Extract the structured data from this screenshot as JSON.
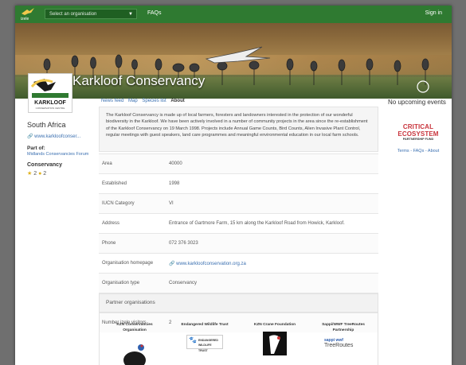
{
  "topbar": {
    "logo_text": "izele",
    "org_select_placeholder": "Select an organisation",
    "faqs_label": "FAQs",
    "signin_label": "Sign in"
  },
  "org": {
    "name": "Karkloof Conservancy",
    "logo_text": "KARKLOOF",
    "logo_subtext": "CONSERVATION CENTRE"
  },
  "tabs": [
    "News feed",
    "Map",
    "Species list",
    "About"
  ],
  "sidebar": {
    "country": "South Africa",
    "website_short": "www.karkloofconser...",
    "part_of_label": "Part of:",
    "part_of_link": "Midlands Conservancies Forum",
    "type_label": "Conservancy",
    "favourites_count": "2",
    "visitors_count": "2"
  },
  "description": "The Karkloof Conservancy is made up of local farmers, foresters and landowners interested in the protection of our wonderful biodiversity in the Karkloof. We have been actively involved in a number of community projects in the area since the re-establishment of the Karkloof Conservancy on 19 March 1998. Projects include Annual Game Counts, Bird Counts, Alien Invasive Plant Control, regular meetings with guest speakers, land care programmes and meaningful environmental education in our local farm schools.",
  "info_rows": [
    {
      "key": "Area",
      "value": "40000"
    },
    {
      "key": "Established",
      "value": "1998"
    },
    {
      "key": "IUCN Category",
      "value": "VI"
    },
    {
      "key": "Address",
      "value": "Entrance of Gartmore Farm, 15 km along the Karkloof Road from Howick, Karkloof."
    },
    {
      "key": "Phone",
      "value": "072 376 3023"
    },
    {
      "key": "Organisation homepage",
      "value": "www.karkloofconservation.org.za"
    },
    {
      "key": "Organisation type",
      "value": "Conservancy"
    },
    {
      "key": "Number favourites",
      "value": "2"
    },
    {
      "key": "Number izele visitors",
      "value": "2"
    }
  ],
  "partners": {
    "heading": "Partner organisations",
    "items": [
      "KZN Conservancies Organisation",
      "Endangered Wildlife Trust",
      "KZN Crane Foundation",
      "Sappi/WWF TreeRoutes Partnership"
    ],
    "ewt_logo_text": "ENDANGERED WILDLIFE TRUST",
    "sappi_logo_text": "sappi wwf",
    "treeroutes_logo_text": "TreeRoutes"
  },
  "right": {
    "upcoming": "No upcoming events",
    "cepf_line1": "CRITICAL ECOSYSTEM",
    "cepf_line2": "PARTNERSHIP FUND",
    "footer_links": "Terms - FAQs - About"
  },
  "colors": {
    "topbar": "#2f7a31",
    "link": "#3a6fb0",
    "cepf_red": "#c8343c"
  }
}
